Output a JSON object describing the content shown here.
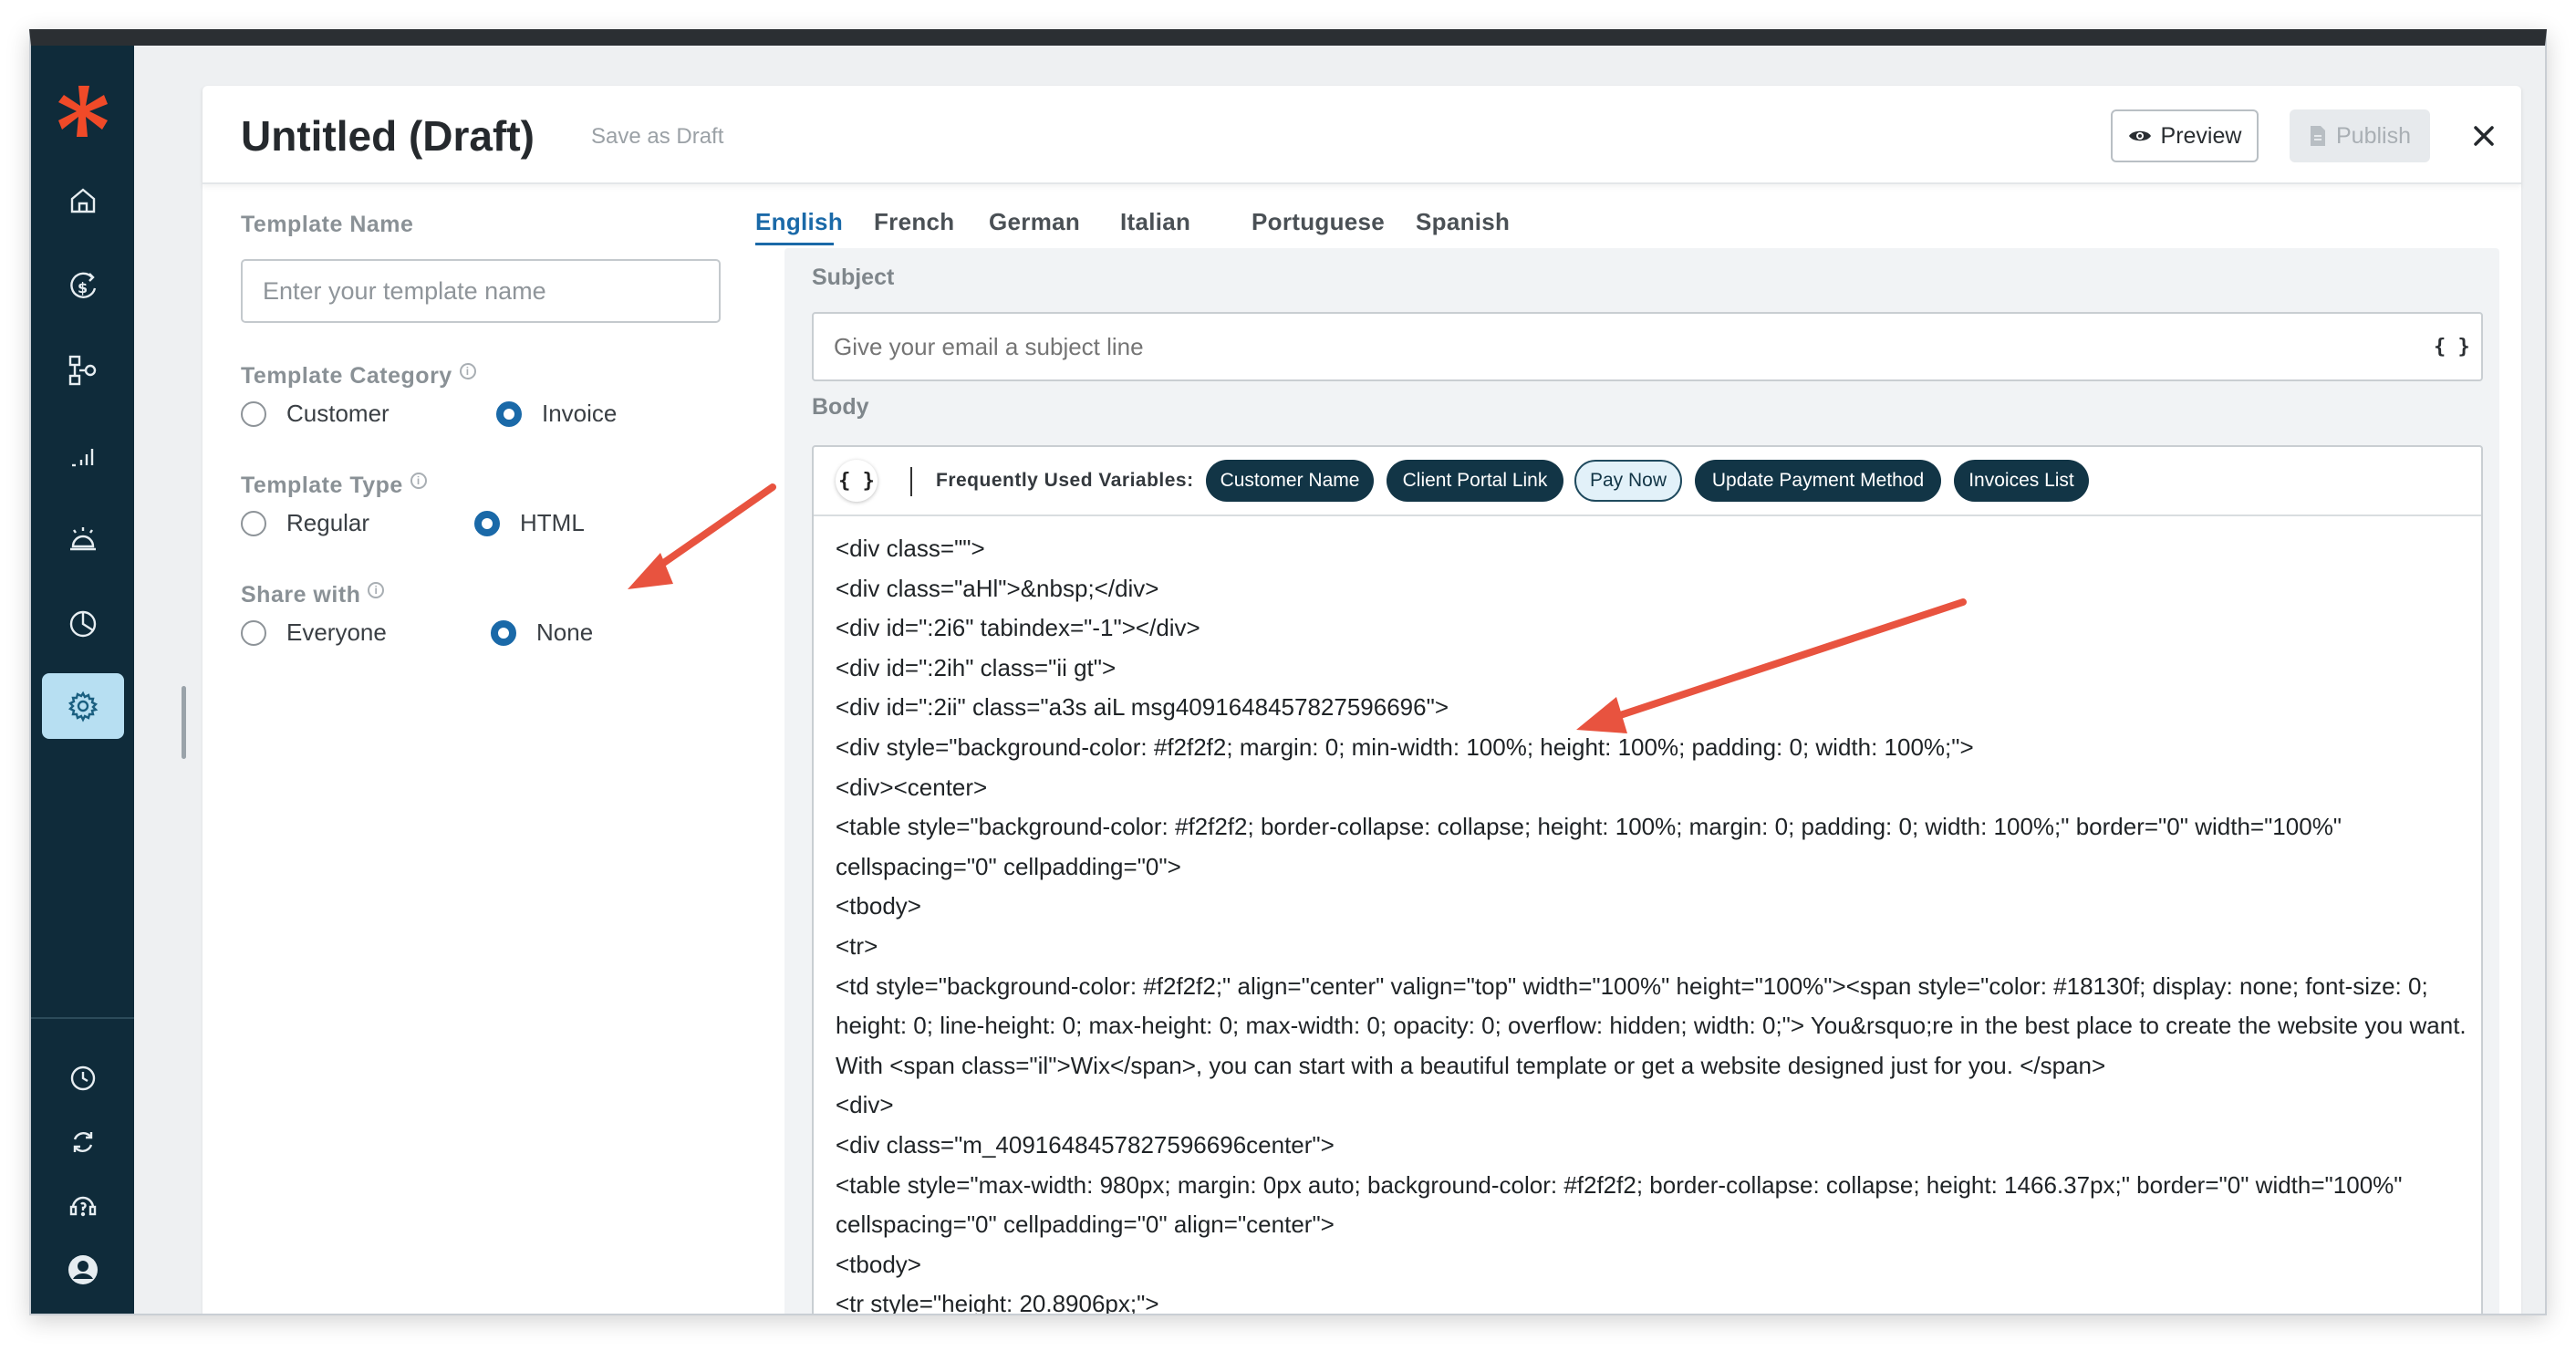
{
  "sidebar": {
    "items": [
      {
        "icon": "home-icon"
      },
      {
        "icon": "dollar-refresh-icon"
      },
      {
        "icon": "workflow-icon"
      },
      {
        "icon": "bar-chart-icon"
      },
      {
        "icon": "bell-service-icon"
      },
      {
        "icon": "pie-chart-icon"
      },
      {
        "icon": "gear-icon",
        "active": true
      }
    ],
    "bottom_items": [
      {
        "icon": "clock-icon"
      },
      {
        "icon": "sync-icon"
      },
      {
        "icon": "support-icon"
      },
      {
        "icon": "user-avatar-icon"
      }
    ]
  },
  "header": {
    "title": "Untitled (Draft)",
    "save_draft": "Save as Draft",
    "preview_label": "Preview",
    "publish_label": "Publish"
  },
  "form": {
    "template_name_label": "Template Name",
    "template_name_placeholder": "Enter your template name",
    "template_category_label": "Template Category",
    "category_options": [
      "Customer",
      "Invoice"
    ],
    "category_selected": "Invoice",
    "template_type_label": "Template Type",
    "type_options": [
      "Regular",
      "HTML"
    ],
    "type_selected": "HTML",
    "share_with_label": "Share with",
    "share_options": [
      "Everyone",
      "None"
    ],
    "share_selected": "None"
  },
  "languages": {
    "tabs": [
      "English",
      "French",
      "German",
      "Italian",
      "Portuguese",
      "Spanish"
    ],
    "active": "English"
  },
  "editor": {
    "subject_label": "Subject",
    "subject_placeholder": "Give your email a subject line",
    "variable_button": "{ }",
    "body_label": "Body",
    "frequently_used_label": "Frequently Used Variables:",
    "variables": [
      "Customer Name",
      "Client Portal Link",
      "Pay Now",
      "Update Payment Method",
      "Invoices List"
    ],
    "highlighted_variable": "Pay Now",
    "code_lines": [
      "<div class=\"\">",
      "<div class=\"aHl\">&nbsp;</div>",
      "<div id=\":2i6\" tabindex=\"-1\"></div>",
      "<div id=\":2ih\" class=\"ii gt\">",
      "<div id=\":2ii\" class=\"a3s aiL msg4091648457827596696\">",
      "<div style=\"background-color: #f2f2f2; margin: 0; min-width: 100%; height: 100%; padding: 0; width: 100%;\">",
      "<div><center>",
      "<table style=\"background-color: #f2f2f2; border-collapse: collapse; height: 100%; margin: 0; padding: 0; width: 100%;\" border=\"0\" width=\"100%\"",
      "cellspacing=\"0\" cellpadding=\"0\">",
      "<tbody>",
      "<tr>",
      "<td style=\"background-color: #f2f2f2;\" align=\"center\" valign=\"top\" width=\"100%\" height=\"100%\"><span style=\"color: #18130f; display: none; font-size: 0;",
      "height: 0; line-height: 0; max-height: 0; max-width: 0; opacity: 0; overflow: hidden; width: 0;\"> You&rsquo;re in the best place to create the website you want.",
      "With <span class=\"il\">Wix</span>, you can start with a beautiful template or get a website designed just for you. </span>",
      "<div>",
      "<div class=\"m_4091648457827596696center\">",
      "<table style=\"max-width: 980px; margin: 0px auto; background-color: #f2f2f2; border-collapse: collapse; height: 1466.37px;\" border=\"0\" width=\"100%\"",
      "cellspacing=\"0\" cellpadding=\"0\" align=\"center\">",
      "<tbody>",
      "<tr style=\"height: 20.8906px;\">"
    ]
  },
  "colors": {
    "sidebar_bg": "#0f2b3a",
    "accent_blue": "#1a69a8",
    "chip_dark": "#123546",
    "logo_red": "#f04a28",
    "annotation_arrow": "#e8533f"
  }
}
